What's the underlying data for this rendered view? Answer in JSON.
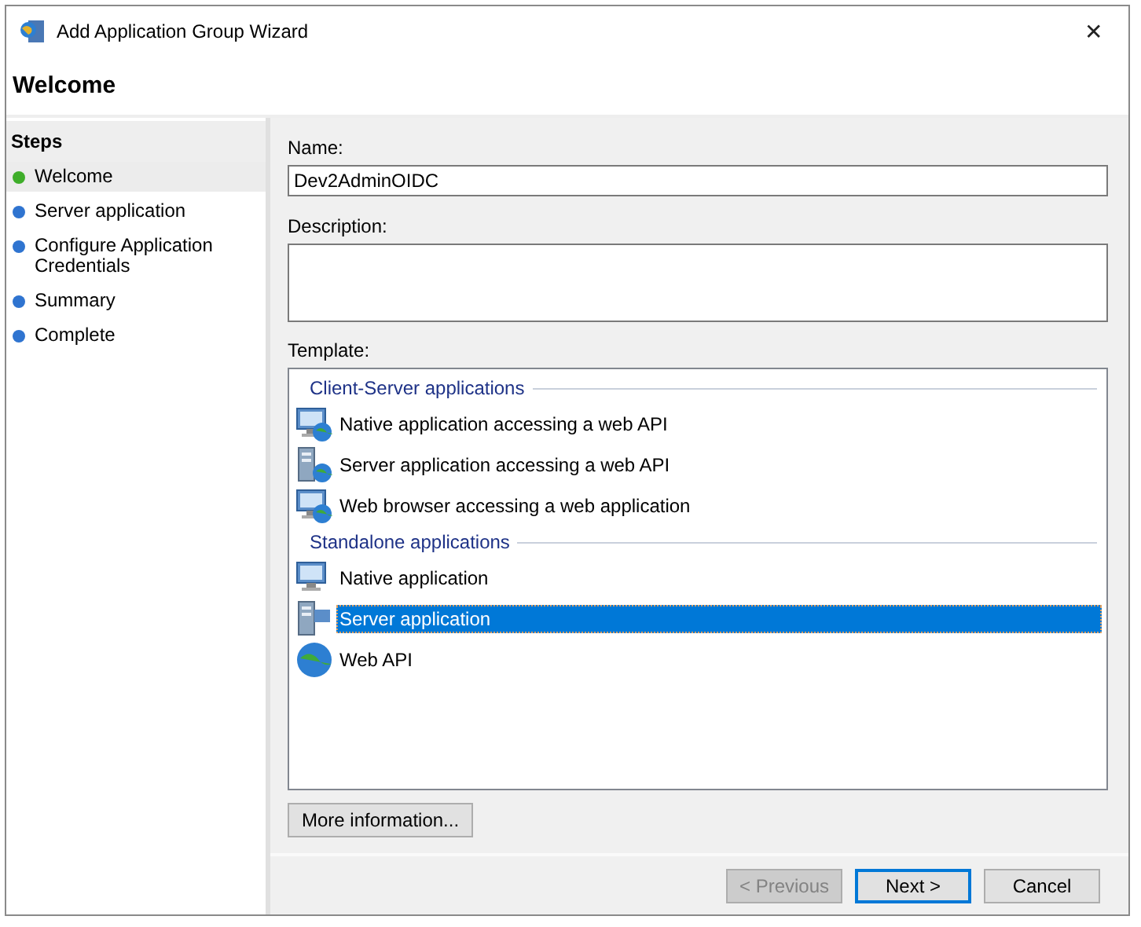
{
  "window": {
    "title": "Add Application Group Wizard",
    "close": "✕"
  },
  "page_title": "Welcome",
  "steps": {
    "title": "Steps",
    "items": [
      {
        "label": "Welcome",
        "selected": true
      },
      {
        "label": "Server application",
        "selected": false
      },
      {
        "label": "Configure Application Credentials",
        "selected": false
      },
      {
        "label": "Summary",
        "selected": false
      },
      {
        "label": "Complete",
        "selected": false
      }
    ]
  },
  "name": {
    "label": "Name:",
    "value": "Dev2AdminOIDC"
  },
  "description": {
    "label": "Description:"
  },
  "template": {
    "label": "Template:",
    "items": [
      {
        "kind": "group",
        "label": "Client-Server applications"
      },
      {
        "kind": "item",
        "label": "Native application accessing a web API",
        "selected": false
      },
      {
        "kind": "item",
        "label": "Server application accessing a web API",
        "selected": false
      },
      {
        "kind": "item",
        "label": "Web browser accessing a web application",
        "selected": false
      },
      {
        "kind": "group",
        "label": "Standalone applications"
      },
      {
        "kind": "item",
        "label": "Native application",
        "selected": false
      },
      {
        "kind": "item",
        "label": "Server application",
        "selected": true
      },
      {
        "kind": "item",
        "label": "Web API",
        "selected": false
      }
    ]
  },
  "more_info": "More information...",
  "buttons": [
    {
      "label": "< Previous",
      "disabled": true,
      "default": false
    },
    {
      "label": "Next >",
      "disabled": false,
      "default": true
    },
    {
      "label": "Cancel",
      "disabled": false,
      "default": false
    }
  ]
}
